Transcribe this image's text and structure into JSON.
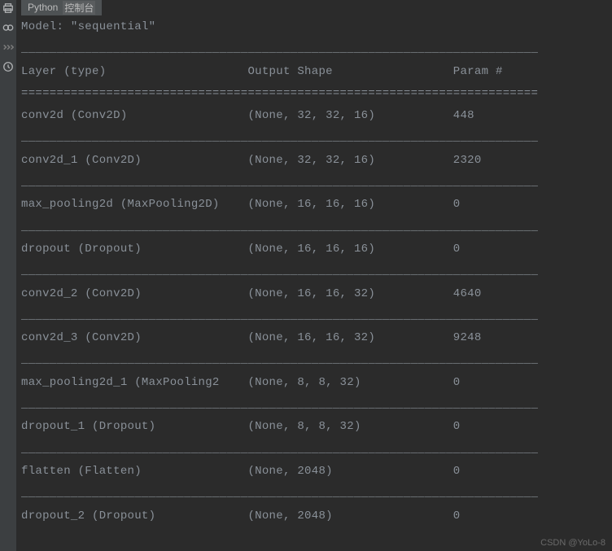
{
  "tab": {
    "lang": "Python",
    "console_label": "控制台"
  },
  "toolbar_icons": [
    "print",
    "loop",
    "chevrons",
    "clock"
  ],
  "model_name": "Model: \"sequential\"",
  "headers": {
    "layer": "Layer (type)",
    "output": "Output Shape",
    "param": "Param #"
  },
  "separator_thin": "_________________________________________________________________________",
  "separator_thick": "=========================================================================",
  "rows": [
    {
      "layer": "conv2d (Conv2D)",
      "shape": "(None, 32, 32, 16)",
      "params": "448"
    },
    {
      "layer": "conv2d_1 (Conv2D)",
      "shape": "(None, 32, 32, 16)",
      "params": "2320"
    },
    {
      "layer": "max_pooling2d (MaxPooling2D)",
      "shape": "(None, 16, 16, 16)",
      "params": "0"
    },
    {
      "layer": "dropout (Dropout)",
      "shape": "(None, 16, 16, 16)",
      "params": "0"
    },
    {
      "layer": "conv2d_2 (Conv2D)",
      "shape": "(None, 16, 16, 32)",
      "params": "4640"
    },
    {
      "layer": "conv2d_3 (Conv2D)",
      "shape": "(None, 16, 16, 32)",
      "params": "9248"
    },
    {
      "layer": "max_pooling2d_1 (MaxPooling2",
      "shape": "(None, 8, 8, 32)",
      "params": "0"
    },
    {
      "layer": "dropout_1 (Dropout)",
      "shape": "(None, 8, 8, 32)",
      "params": "0"
    },
    {
      "layer": "flatten (Flatten)",
      "shape": "(None, 2048)",
      "params": "0"
    },
    {
      "layer": "dropout_2 (Dropout)",
      "shape": "(None, 2048)",
      "params": "0"
    }
  ],
  "col_widths": {
    "layer": 32,
    "shape": 29
  },
  "watermark": "CSDN @YoLo-8"
}
